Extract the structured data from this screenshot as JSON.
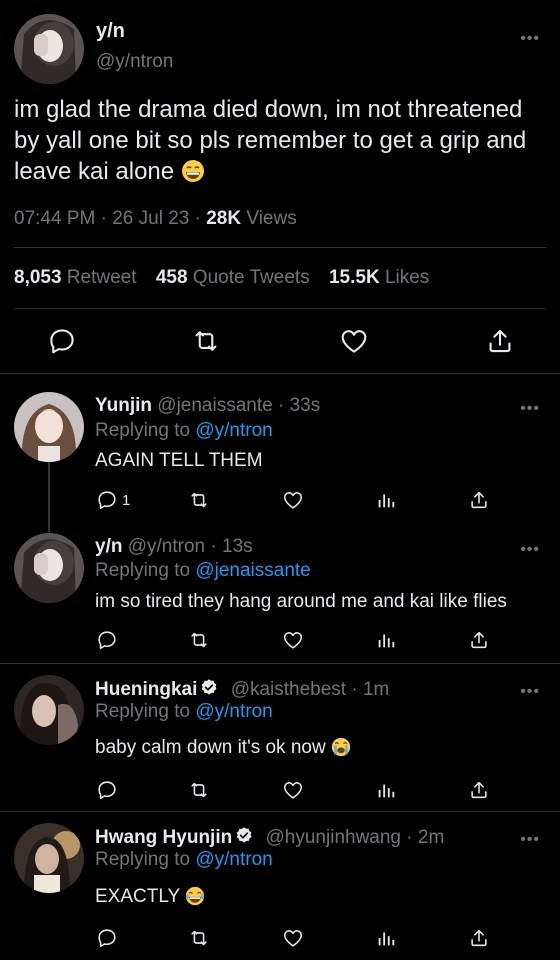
{
  "main_tweet": {
    "display_name": "y/n",
    "handle": "@y/ntron",
    "text": "im glad the drama died down, im not threatened by yall one bit so pls remember to get a grip and leave kai alone",
    "emoji": "grinning-face",
    "time": "07:44 PM",
    "date": "26 Jul 23",
    "views_count": "28K",
    "views_label": "Views",
    "retweets_count": "8,053",
    "retweets_label": "Retweet",
    "quotes_count": "458",
    "quotes_label": "Quote Tweets",
    "likes_count": "15.5K",
    "likes_label": "Likes",
    "more": "•••"
  },
  "replies": [
    {
      "display_name": "Yunjin",
      "handle": "@jenaissante",
      "time": "33s",
      "replying_label": "Replying to",
      "replying_to": "@y/ntron",
      "text": "AGAIN TELL THEM",
      "reply_count": "1",
      "verified": false,
      "more": "•••"
    },
    {
      "display_name": "y/n",
      "handle": "@y/ntron",
      "time": "13s",
      "replying_label": "Replying to",
      "replying_to": "@jenaissante",
      "text": "im so tired they hang around me and kai like flies",
      "reply_count": "",
      "verified": false,
      "more": "•••"
    },
    {
      "display_name": "Hueningkai",
      "handle": "@kaisthebest",
      "time": "1m",
      "replying_label": "Replying to",
      "replying_to": "@y/ntron",
      "text": "baby calm down it's ok now",
      "emoji": "loudly-crying-face",
      "reply_count": "",
      "verified": true,
      "more": "•••"
    },
    {
      "display_name": "Hwang Hyunjin",
      "handle": "@hyunjinhwang",
      "time": "2m",
      "replying_label": "Replying to",
      "replying_to": "@y/ntron",
      "text": "EXACTLY",
      "emoji": "face-with-tears-of-joy",
      "reply_count": "",
      "verified": true,
      "more": "•••"
    }
  ],
  "separator": "·",
  "colors": {
    "background": "#000000",
    "text": "#e7e9ea",
    "muted": "#71767b",
    "link": "#1d9bf0",
    "divider": "#2f3336"
  },
  "icons": [
    "reply-icon",
    "retweet-icon",
    "like-icon",
    "share-icon",
    "views-icon",
    "verified-badge-icon"
  ]
}
